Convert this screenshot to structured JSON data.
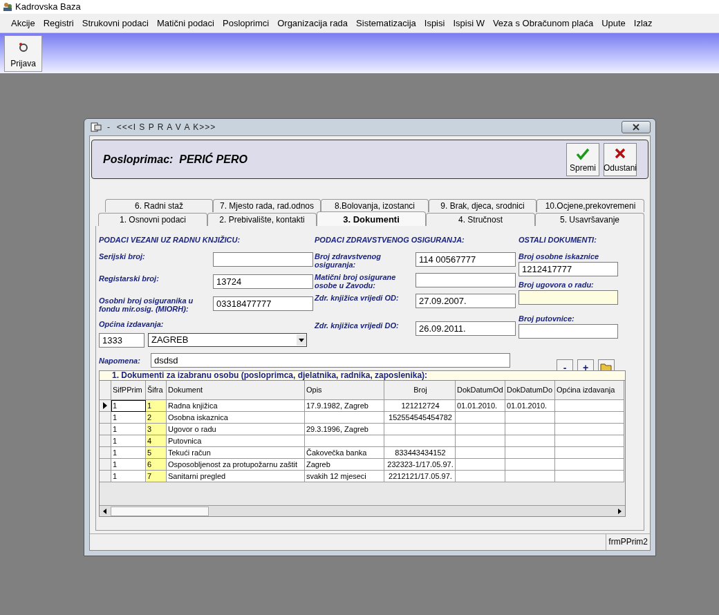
{
  "app": {
    "title": "Kadrovska Baza"
  },
  "menu": [
    "Akcije",
    "Registri",
    "Strukovni podaci",
    "Matični podaci",
    "Posloprimci",
    "Organizacija rada",
    "Sistematizacija",
    "Ispisi",
    "Ispisi W",
    "Veza s Obračunom plaća",
    "Upute",
    "Izlaz"
  ],
  "toolbar": [
    {
      "label": "Prijava"
    }
  ],
  "dialog": {
    "title": "-  <<<I S P R A V A K>>>",
    "heading": "Posloprimac:  PERIĆ PERO",
    "actions": [
      {
        "kind": "save",
        "label": "Spremi"
      },
      {
        "kind": "cancel",
        "label": "Odustani"
      }
    ],
    "tab_rows": [
      [
        {
          "label": "6. Radni staž",
          "selected": false
        },
        {
          "label": "7. Mjesto rada, rad.odnos",
          "selected": false
        },
        {
          "label": "8.Bolovanja, izostanci",
          "selected": false
        },
        {
          "label": "9. Brak, djeca, srodnici",
          "selected": false
        },
        {
          "label": "10.Ocjene,prekovremeni",
          "selected": false
        }
      ],
      [
        {
          "label": "1. Osnovni podaci",
          "selected": false
        },
        {
          "label": "2. Prebivalište, kontakti",
          "selected": false
        },
        {
          "label": "3. Dokumenti",
          "selected": true
        },
        {
          "label": "4. Stručnost",
          "selected": false
        },
        {
          "label": "5. Usavršavanje",
          "selected": false
        }
      ]
    ],
    "sections": [
      {
        "title": "PODACI VEZANI UZ RADNU KNJIŽICU:",
        "fields": [
          {
            "label": "Serijski broj:"
          },
          {
            "label": "Registarski broj:",
            "value": "13724"
          },
          {
            "label": "Osobni broj osiguranika u fondu mir.osig. (MIORH):",
            "value": "03318477777"
          }
        ]
      },
      {
        "title": "PODACI ZDRAVSTVENOG OSIGURANJA:",
        "fields": [
          {
            "label": "Broj zdravstvenog osiguranja:",
            "value": "114 00567777"
          },
          {
            "label": "Matični broj osigurane osobe u Zavodu:"
          },
          {
            "label": "Zdr. knjižica vrijedi OD:",
            "value": "27.09.2007."
          },
          {
            "label": "Zdr. knjižica vrijedi DO:",
            "value": "26.09.2011."
          }
        ]
      },
      {
        "title": "OSTALI DOKUMENTI:",
        "fields": [
          {
            "label": "Broj osobne iskaznice",
            "value": "1212417777",
            "highlighted": false
          },
          {
            "label": "Broj ugovora o radu:",
            "highlighted": true
          },
          {
            "label": "Broj putovnice:",
            "highlighted": false
          }
        ]
      }
    ],
    "municipality": {
      "label": "Općina izdavanja:",
      "code": "1333",
      "name": "ZAGREB"
    },
    "note": {
      "label": "Napomena:",
      "value": "dsdsd"
    },
    "grid_buttons": [
      {
        "kind": "remove",
        "label": "-"
      },
      {
        "kind": "add",
        "label": "+"
      },
      {
        "kind": "open"
      }
    ],
    "table": {
      "caption": "1. Dokumenti za izabranu osobu (posloprimca, djelatnika, radnika, zaposlenika):",
      "columns": [
        "SifPPrim",
        "Šifra",
        "Dokument",
        "Opis",
        "Broj",
        "DokDatumOd",
        "DokDatumDo",
        "Općina izdavanja"
      ],
      "rows": [
        {
          "selected": true,
          "cells": [
            "1",
            "1",
            "Radna knjižica",
            "17.9.1982, Zagreb",
            "121212724",
            "01.01.2010.",
            "01.01.2010.",
            ""
          ]
        },
        {
          "selected": false,
          "cells": [
            "1",
            "2",
            "Osobna iskaznica",
            "",
            "152554545454782",
            "",
            "",
            ""
          ]
        },
        {
          "selected": false,
          "cells": [
            "1",
            "3",
            "Ugovor o radu",
            "29.3.1996, Zagreb",
            "",
            "",
            "",
            ""
          ]
        },
        {
          "selected": false,
          "cells": [
            "1",
            "4",
            "Putovnica",
            "",
            "",
            "",
            "",
            ""
          ]
        },
        {
          "selected": false,
          "cells": [
            "1",
            "5",
            "Tekući račun",
            "Čakovečka banka",
            "833443434152",
            "",
            "",
            ""
          ]
        },
        {
          "selected": false,
          "cells": [
            "1",
            "6",
            "Osposobljenost za protupožarnu zaštit",
            "Zagreb",
            "232323-1/17.05.97.",
            "",
            "",
            ""
          ]
        },
        {
          "selected": false,
          "cells": [
            "1",
            "7",
            "Sanitarni pregled",
            "svakih 12 mjeseci",
            "2212121/17.05.97.",
            "",
            "",
            ""
          ]
        }
      ]
    },
    "status": "frmPPrim2"
  }
}
